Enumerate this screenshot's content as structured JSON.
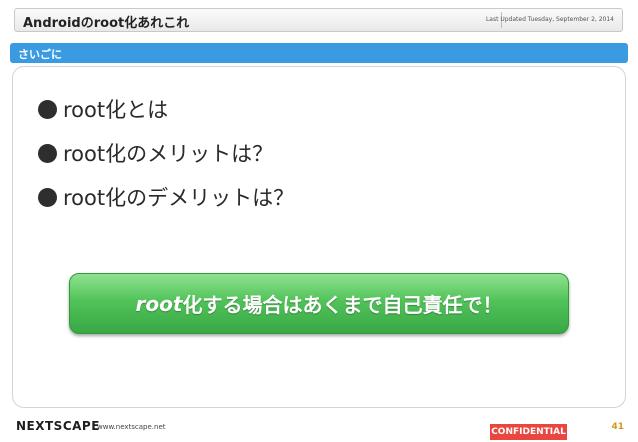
{
  "header": {
    "title": "Androidのroot化あれこれ",
    "date": "Last Updated Tuesday, September 2, 2014"
  },
  "section": {
    "label": "さいごに"
  },
  "bullets": [
    {
      "text": "root化とは"
    },
    {
      "text": "root化のメリットは？"
    },
    {
      "text": "root化のデメリットは？"
    }
  ],
  "callout": {
    "emphasis": "root",
    "text": "化する場合はあくまで自己責任で！",
    "color": "#52c35a"
  },
  "footer": {
    "logo": "NEXTSCAPE",
    "url": "www.nextscape.net",
    "confidential": "CONFIDENTIAL",
    "confidential_color": "#e8463e",
    "page": "41"
  }
}
